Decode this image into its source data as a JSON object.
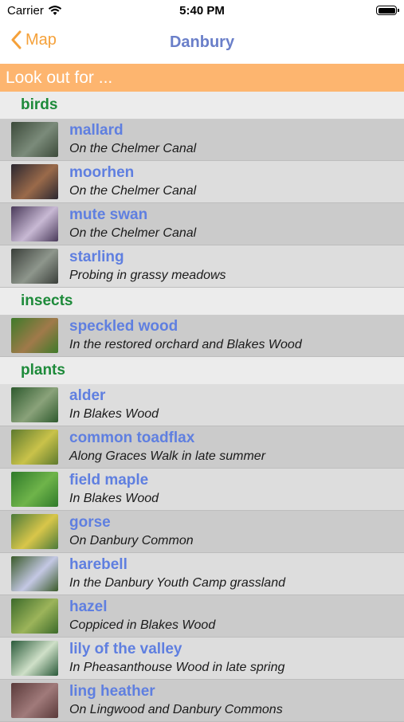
{
  "status_bar": {
    "carrier": "Carrier",
    "time": "5:40 PM"
  },
  "nav": {
    "back_label": "Map",
    "title": "Danbury"
  },
  "banner": {
    "text": "Look out for ..."
  },
  "sections": [
    {
      "header": "birds",
      "items": [
        {
          "name": "mallard",
          "desc": "On the Chelmer Canal",
          "thumb": [
            "#3c4a3a",
            "#7b8b7a"
          ]
        },
        {
          "name": "moorhen",
          "desc": "On the Chelmer Canal",
          "thumb": [
            "#2b2730",
            "#9a6a4a"
          ]
        },
        {
          "name": "mute swan",
          "desc": "On the Chelmer Canal",
          "thumb": [
            "#4a3a5a",
            "#c8b9d4"
          ]
        },
        {
          "name": "starling",
          "desc": "Probing in grassy meadows",
          "thumb": [
            "#3a3f3a",
            "#8e968c"
          ]
        }
      ]
    },
    {
      "header": "insects",
      "items": [
        {
          "name": "speckled wood",
          "desc": "In the restored orchard and Blakes Wood",
          "thumb": [
            "#3f7a2a",
            "#a07a4a"
          ]
        }
      ]
    },
    {
      "header": "plants",
      "items": [
        {
          "name": "alder",
          "desc": "In Blakes Wood",
          "thumb": [
            "#2e5a2e",
            "#8aa27a"
          ]
        },
        {
          "name": "common toadflax",
          "desc": "Along Graces Walk in late summer",
          "thumb": [
            "#5e7a2e",
            "#c9c24a"
          ]
        },
        {
          "name": "field maple",
          "desc": "In Blakes Wood",
          "thumb": [
            "#2f7a2a",
            "#6fb44a"
          ]
        },
        {
          "name": "gorse",
          "desc": "On Danbury Common",
          "thumb": [
            "#4c7a3a",
            "#d8c64a"
          ]
        },
        {
          "name": "harebell",
          "desc": "In the Danbury Youth Camp grassland",
          "thumb": [
            "#3a5a2a",
            "#c4c8e4"
          ]
        },
        {
          "name": "hazel",
          "desc": "Coppiced in Blakes Wood",
          "thumb": [
            "#3c6a2a",
            "#9cb45a"
          ]
        },
        {
          "name": "lily of the valley",
          "desc": "In Pheasanthouse Wood in late spring",
          "thumb": [
            "#2a5a3a",
            "#cfe0c8"
          ]
        },
        {
          "name": "ling heather",
          "desc": "On Lingwood and Danbury Commons",
          "thumb": [
            "#5a3a3a",
            "#a07a7a"
          ]
        }
      ]
    }
  ]
}
